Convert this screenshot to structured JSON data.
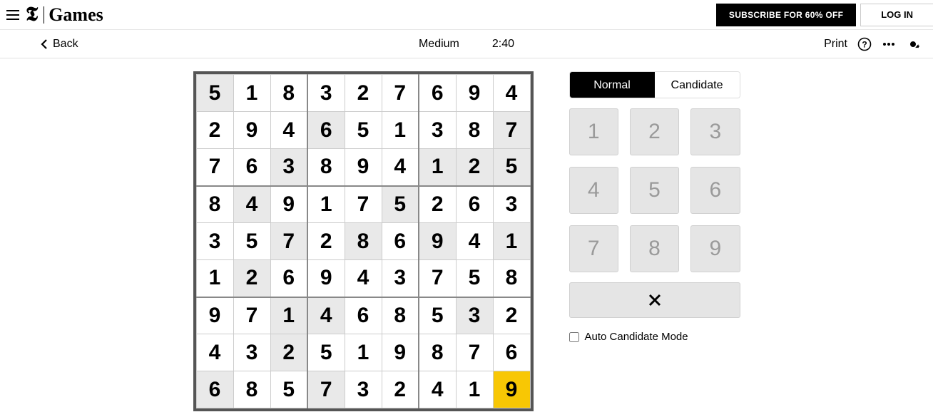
{
  "header": {
    "brand": "Games",
    "subscribe_label": "SUBSCRIBE FOR 60% OFF",
    "login_label": "LOG IN"
  },
  "toolbar": {
    "back_label": "Back",
    "difficulty": "Medium",
    "timer": "2:40",
    "print_label": "Print"
  },
  "sudoku": {
    "grid": [
      [
        {
          "v": "5",
          "g": true
        },
        {
          "v": "1"
        },
        {
          "v": "8"
        },
        {
          "v": "3"
        },
        {
          "v": "2"
        },
        {
          "v": "7"
        },
        {
          "v": "6"
        },
        {
          "v": "9"
        },
        {
          "v": "4"
        }
      ],
      [
        {
          "v": "2"
        },
        {
          "v": "9"
        },
        {
          "v": "4"
        },
        {
          "v": "6",
          "g": true
        },
        {
          "v": "5"
        },
        {
          "v": "1"
        },
        {
          "v": "3"
        },
        {
          "v": "8"
        },
        {
          "v": "7",
          "g": true
        }
      ],
      [
        {
          "v": "7"
        },
        {
          "v": "6"
        },
        {
          "v": "3",
          "g": true
        },
        {
          "v": "8"
        },
        {
          "v": "9"
        },
        {
          "v": "4"
        },
        {
          "v": "1",
          "g": true
        },
        {
          "v": "2",
          "g": true
        },
        {
          "v": "5",
          "g": true
        }
      ],
      [
        {
          "v": "8"
        },
        {
          "v": "4",
          "g": true
        },
        {
          "v": "9"
        },
        {
          "v": "1"
        },
        {
          "v": "7"
        },
        {
          "v": "5",
          "g": true
        },
        {
          "v": "2"
        },
        {
          "v": "6"
        },
        {
          "v": "3"
        }
      ],
      [
        {
          "v": "3"
        },
        {
          "v": "5"
        },
        {
          "v": "7",
          "g": true
        },
        {
          "v": "2"
        },
        {
          "v": "8",
          "g": true
        },
        {
          "v": "6"
        },
        {
          "v": "9",
          "g": true
        },
        {
          "v": "4"
        },
        {
          "v": "1",
          "g": true
        }
      ],
      [
        {
          "v": "1"
        },
        {
          "v": "2",
          "g": true
        },
        {
          "v": "6"
        },
        {
          "v": "9"
        },
        {
          "v": "4"
        },
        {
          "v": "3"
        },
        {
          "v": "7"
        },
        {
          "v": "5"
        },
        {
          "v": "8"
        }
      ],
      [
        {
          "v": "9"
        },
        {
          "v": "7"
        },
        {
          "v": "1",
          "g": true
        },
        {
          "v": "4",
          "g": true
        },
        {
          "v": "6"
        },
        {
          "v": "8"
        },
        {
          "v": "5"
        },
        {
          "v": "3",
          "g": true
        },
        {
          "v": "2"
        }
      ],
      [
        {
          "v": "4"
        },
        {
          "v": "3"
        },
        {
          "v": "2",
          "g": true
        },
        {
          "v": "5"
        },
        {
          "v": "1"
        },
        {
          "v": "9"
        },
        {
          "v": "8"
        },
        {
          "v": "7"
        },
        {
          "v": "6"
        }
      ],
      [
        {
          "v": "6",
          "g": true
        },
        {
          "v": "8"
        },
        {
          "v": "5"
        },
        {
          "v": "7",
          "g": true
        },
        {
          "v": "3"
        },
        {
          "v": "2"
        },
        {
          "v": "4"
        },
        {
          "v": "1"
        },
        {
          "v": "9",
          "s": true
        }
      ]
    ]
  },
  "panel": {
    "tabs": [
      {
        "label": "Normal",
        "active": true
      },
      {
        "label": "Candidate",
        "active": false
      }
    ],
    "numbers": [
      "1",
      "2",
      "3",
      "4",
      "5",
      "6",
      "7",
      "8",
      "9"
    ],
    "auto_candidate_label": "Auto Candidate Mode"
  }
}
